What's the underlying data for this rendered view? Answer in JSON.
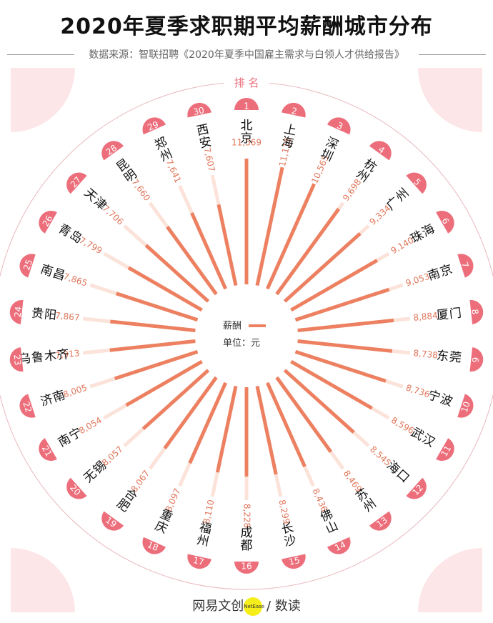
{
  "header": {
    "title": "2020年夏季求职期平均薪酬城市分布",
    "source": "数据来源：智联招聘《2020年夏季中国雇主需求与白领人才供给报告》"
  },
  "legend": {
    "rank_label": "排 名",
    "salary_label": "薪酬",
    "unit_label": "单位：元"
  },
  "footer": {
    "brand": "网易文创",
    "brand_badge": "NetEase",
    "separator": "/",
    "sub_brand": "数读"
  },
  "colors": {
    "bar": "#ec8060",
    "bar_light": "#fbe3da",
    "badge": "#ec6e7b",
    "corner": "#fde6e8",
    "value_text": "#e0765a"
  },
  "chart_data": {
    "type": "radial-bar",
    "title": "2020年夏季求职期平均薪酬城市分布",
    "unit": "元",
    "ranks": [
      1,
      2,
      3,
      4,
      5,
      6,
      7,
      8,
      9,
      10,
      11,
      12,
      13,
      14,
      15,
      16,
      17,
      18,
      19,
      20,
      21,
      22,
      23,
      24,
      25,
      26,
      27,
      28,
      29,
      30
    ],
    "categories": [
      "北京",
      "上海",
      "深圳",
      "杭州",
      "广州",
      "珠海",
      "南京",
      "厦门",
      "东莞",
      "宁波",
      "武汉",
      "海口",
      "苏州",
      "佛山",
      "长沙",
      "成都",
      "福州",
      "重庆",
      "合肥",
      "无锡",
      "南宁",
      "济南",
      "乌鲁木齐",
      "贵阳",
      "南昌",
      "青岛",
      "天津",
      "昆明",
      "郑州",
      "西安"
    ],
    "values": [
      11569,
      11115,
      10565,
      9698,
      9334,
      9140,
      9053,
      8884,
      8738,
      8736,
      8596,
      8545,
      8469,
      8436,
      8299,
      8228,
      8110,
      8097,
      8067,
      8057,
      8054,
      8005,
      7913,
      7867,
      7865,
      7799,
      7706,
      7660,
      7641,
      7607
    ],
    "value_labels": [
      "11,569",
      "11,115",
      "10,565",
      "9,698",
      "9,334",
      "9,140",
      "9,053",
      "8,884",
      "8,738",
      "8,736",
      "8,596",
      "8,545",
      "8,469",
      "8,436",
      "8,299",
      "8,228",
      "8,110",
      "8,097",
      "8,067",
      "8,057",
      "8,054",
      "8,005",
      "7,913",
      "7,867",
      "7,865",
      "7,799",
      "7,706",
      "7,660",
      "7,641",
      "7,607"
    ]
  }
}
